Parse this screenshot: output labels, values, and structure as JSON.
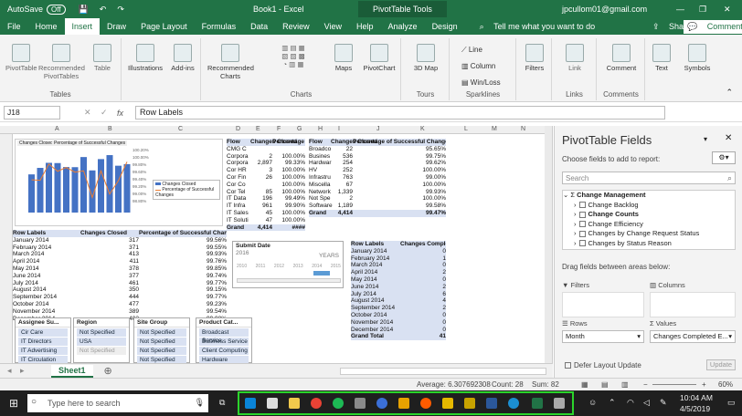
{
  "titlebar": {
    "autosave": "AutoSave",
    "autosave_state": "Off",
    "doc": "Book1 - Excel",
    "tools": "PivotTable Tools",
    "user": "jpcullom01@gmail.com"
  },
  "tabs": [
    "File",
    "Home",
    "Insert",
    "Draw",
    "Page Layout",
    "Formulas",
    "Data",
    "Review",
    "View",
    "Help",
    "Analyze",
    "Design"
  ],
  "tell_me": "Tell me what you want to do",
  "share": "Share",
  "comments": "Comments",
  "ribbon": {
    "tables": {
      "label": "Tables",
      "items": [
        "PivotTable",
        "Recommended PivotTables",
        "Table"
      ]
    },
    "illustrations": "Illustrations",
    "addins": "Add-ins",
    "charts": {
      "label": "Charts",
      "items": [
        "Recommended Charts",
        "Maps",
        "PivotChart"
      ]
    },
    "tours": {
      "label": "Tours",
      "items": [
        "3D Map"
      ]
    },
    "sparklines": {
      "label": "Sparklines",
      "items": [
        "Line",
        "Column",
        "Win/Loss"
      ]
    },
    "filters": "Filters",
    "links": {
      "label": "Links",
      "items": [
        "Link"
      ]
    },
    "comments": {
      "label": "Comments",
      "items": [
        "Comment"
      ]
    },
    "text": "Text",
    "symbols": "Symbols"
  },
  "namebox": "J18",
  "formula": "Row Labels",
  "columns": [
    "A",
    "B",
    "C",
    "D",
    "E",
    "F",
    "G",
    "H",
    "I",
    "J",
    "K",
    "L",
    "M",
    "N"
  ],
  "pivot_left": {
    "headers": [
      "Row Labels",
      "Changes Closed",
      "Percentage of Successful Changes"
    ],
    "rows": [
      [
        "January 2014",
        "317",
        "99.56%"
      ],
      [
        "February 2014",
        "371",
        "99.55%"
      ],
      [
        "March 2014",
        "413",
        "99.93%"
      ],
      [
        "April 2014",
        "411",
        "99.76%"
      ],
      [
        "May 2014",
        "378",
        "99.85%"
      ],
      [
        "June 2014",
        "377",
        "99.74%"
      ],
      [
        "July 2014",
        "461",
        "99.77%"
      ],
      [
        "August 2014",
        "350",
        "99.15%"
      ],
      [
        "September 2014",
        "444",
        "99.77%"
      ],
      [
        "October 2014",
        "477",
        "99.23%"
      ],
      [
        "November 2014",
        "389",
        "99.54%"
      ],
      [
        "December 2014",
        "402",
        "99.98%"
      ]
    ]
  },
  "pivot_flow1": {
    "headers": [
      "Flow",
      "Changes Closed",
      "Percentage of"
    ],
    "rows": [
      [
        "CMG C",
        "",
        ""
      ],
      [
        "Corpora",
        "2",
        "100.00%"
      ],
      [
        "Corpora",
        "2,897",
        "99.33%"
      ],
      [
        "Cor HR",
        "3",
        "100.00%"
      ],
      [
        "Cor Fin",
        "26",
        "100.00%"
      ],
      [
        "Cor Co",
        "",
        "100.00%"
      ],
      [
        "Cor Tel",
        "85",
        "100.00%"
      ],
      [
        "IT Data",
        "196",
        "99.49%"
      ],
      [
        "IT Infra",
        "961",
        "99.90%"
      ],
      [
        "IT Sales",
        "45",
        "100.00%"
      ],
      [
        "IT Soluti",
        "47",
        "100.00%"
      ]
    ],
    "total": [
      "Grand",
      "4,414",
      "####"
    ]
  },
  "pivot_flow2": {
    "headers": [
      "Flow",
      "Changes Closed",
      "Percentage of Successful Changes"
    ],
    "rows": [
      [
        "Broadco",
        "22",
        "95.65%"
      ],
      [
        "Busines",
        "536",
        "99.75%"
      ],
      [
        "Hardwar",
        "254",
        "99.62%"
      ],
      [
        "HV",
        "252",
        "100.00%"
      ],
      [
        "Infrastru",
        "763",
        "99.00%"
      ],
      [
        "Miscella",
        "67",
        "100.00%"
      ],
      [
        "Network",
        "1,339",
        "99.93%"
      ],
      [
        "Not Spe",
        "2",
        "100.00%"
      ],
      [
        "Software",
        "1,189",
        "99.58%"
      ]
    ],
    "total": [
      "Grand",
      "4,414",
      "99.47%"
    ]
  },
  "pivot_emergency": {
    "headers": [
      "Row Labels",
      "Changes Completed Emergency"
    ],
    "rows": [
      [
        "January 2014",
        "0"
      ],
      [
        "February 2014",
        "1"
      ],
      [
        "March 2014",
        "0"
      ],
      [
        "April 2014",
        "2"
      ],
      [
        "May 2014",
        "0"
      ],
      [
        "June 2014",
        "2"
      ],
      [
        "July 2014",
        "6"
      ],
      [
        "August 2014",
        "4"
      ],
      [
        "September 2014",
        "2"
      ],
      [
        "October 2014",
        "0"
      ],
      [
        "November 2014",
        "0"
      ],
      [
        "December 2014",
        "0"
      ]
    ],
    "total": [
      "Grand Total",
      "41"
    ]
  },
  "timeline": {
    "title": "Submit Date",
    "range": "2016",
    "level": "YEARS",
    "years": [
      "2010",
      "2011",
      "2012",
      "2013",
      "2014",
      "2015"
    ]
  },
  "slicers": [
    {
      "title": "Assignee Su...",
      "items": [
        "Cir Care",
        "IT Directors",
        "IT Advertising",
        "IT Circulation"
      ]
    },
    {
      "title": "Region",
      "items": [
        "Not Specified",
        "USA",
        "Not Specified"
      ]
    },
    {
      "title": "Site Group",
      "items": [
        "Not Specified",
        "Not Specified",
        "Not Specified",
        "Not Specified"
      ]
    },
    {
      "title": "Product Cat...",
      "items": [
        "Broadcast Service",
        "Business Service",
        "Client Computing",
        "Hardware"
      ]
    }
  ],
  "chart": {
    "title": "Changes Closed",
    "legend": [
      "Changes Closed",
      "Percentage of Successful Changes"
    ],
    "right_axis": [
      "100.20%",
      "100.00%",
      "99.80%",
      "99.60%",
      "99.40%",
      "99.20%",
      "99.00%",
      "98.80%"
    ]
  },
  "sheet_tab": "Sheet1",
  "status": {
    "average": "Average: 6.307692308",
    "count": "Count: 28",
    "sum": "Sum: 82",
    "zoom": "60%"
  },
  "panel": {
    "title": "PivotTable Fields",
    "subtitle": "Choose fields to add to report:",
    "search_placeholder": "Search",
    "fields": [
      "Change Management",
      "Change Backlog",
      "Change Counts",
      "Change Efficiency",
      "Changes by Change Request Status",
      "Changes by Status Reason"
    ],
    "drag_label": "Drag fields between areas below:",
    "filters": "Filters",
    "columns": "Columns",
    "rows": "Rows",
    "values": "Values",
    "rows_value": "Month",
    "values_value": "Changes Completed E...",
    "defer": "Defer Layout Update",
    "update": "Update"
  },
  "taskbar": {
    "search": "Type here to search",
    "time": "10:04 AM",
    "date": "4/5/2019"
  },
  "colors": {
    "accent": "#217346",
    "taskbar_highlight": "#2bd42b"
  }
}
